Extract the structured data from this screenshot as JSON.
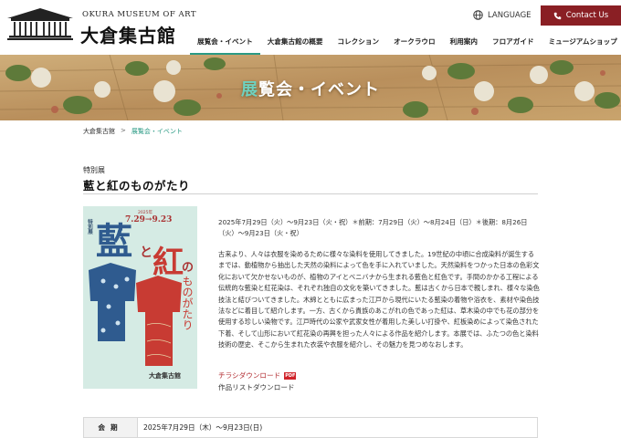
{
  "header": {
    "logo_en": "OKURA MUSEUM OF ART",
    "logo_ja": "大倉集古館",
    "language_label": "LANGUAGE",
    "contact_label": "Contact Us"
  },
  "nav": {
    "items": [
      {
        "label": "展覧会・イベント"
      },
      {
        "label": "大倉集古館の概要"
      },
      {
        "label": "コレクション"
      },
      {
        "label": "オークラウロ"
      },
      {
        "label": "利用案内"
      },
      {
        "label": "フロアガイド"
      },
      {
        "label": "ミュージアムショップ"
      }
    ]
  },
  "hero": {
    "title_accent": "展",
    "title_rest": "覧会・イベント"
  },
  "breadcrumb": {
    "home": "大倉集古館",
    "separator": ">",
    "current": "展覧会・イベント"
  },
  "exhibition": {
    "category": "特別展",
    "title": "藍と紅のものがたり",
    "dates": "2025年7月29日（火）～9月23日（火・祝）＊前期：7月29日（火）～8月24日（日）＊後期：8月26日（火）～9月23日（火・祝）",
    "description": "古来より、人々は衣服を染めるために様々な染料を使用してきました。19世紀の中頃に合成染料が誕生するまでは、動植物から抽出した天然の染料によって色を手に入れていました。天然染料をつかった日本の色彩文化において欠かせないものが、植物のアイとベニバナから生まれる藍色と紅色です。手間のかかる工程による伝統的な藍染と紅花染は、それぞれ独自の文化を築いてきました。藍は古くから日本で親しまれ、様々な染色技法と結びついてきました。木綿とともに広まった江戸から現代にいたる藍染の着物や浴衣を、素材や染色技法などに着目して紹介します。一方、古くから貴族のあこがれの色であった紅は、草木染の中でも花の部分を使用する珍しい染物です。江戸時代の公家や武家女性が着用した美しい打掛や、紅板染めによって染色された下着、そして山形において紅花染の再興を担った人々による作品を紹介します。本展では、ふたつの色と染料技術の歴史、そこから生まれた衣装や衣服を紹介し、その魅力を見つめなおします。",
    "flyer_download": "チラシダウンロード",
    "pdf_badge": "PDF",
    "list_download": "作品リストダウンロード"
  },
  "poster": {
    "tag": "特別展",
    "year": "2025年",
    "dates": "7.29→9.23",
    "ai": "藍",
    "to": "と",
    "beni": "紅",
    "no": "の",
    "rest": "ものがたり",
    "museum": "大倉集古館"
  },
  "info_table": {
    "rows": [
      {
        "th": "会期",
        "td": "2025年7月29日（木）～9月23日(日)"
      }
    ]
  },
  "colors": {
    "accent_teal": "#2a9a84",
    "contact_red": "#8a1f24",
    "link_red": "#b0282d"
  }
}
